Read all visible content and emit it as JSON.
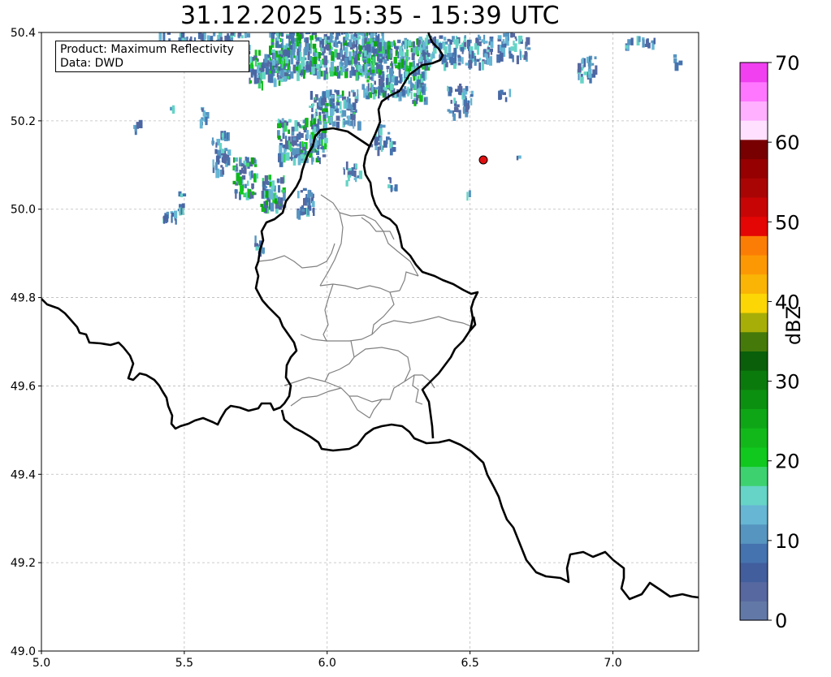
{
  "title": "31.12.2025 15:35 - 15:39 UTC",
  "info_box": {
    "product": "Product: Maximum Reflectivity",
    "data": "Data: DWD"
  },
  "colorbar": {
    "label": "dBZ",
    "min": 0,
    "max": 70,
    "ticks": [
      "0",
      "10",
      "20",
      "30",
      "40",
      "50",
      "60",
      "70"
    ],
    "colors": [
      "#6279a7",
      "#5768a0",
      "#425e9d",
      "#4573af",
      "#5795c1",
      "#66b6d4",
      "#66d4c6",
      "#3dd26f",
      "#10c81e",
      "#12b81a",
      "#0ea616",
      "#0c9010",
      "#0b7a0c",
      "#0a5f0a",
      "#457a0a",
      "#a8ae08",
      "#fcd605",
      "#f9b405",
      "#fd9805",
      "#fc7d05",
      "#e40505",
      "#c80505",
      "#aa0505",
      "#960000",
      "#780000",
      "#ffe0ff",
      "#ffb0ff",
      "#ff77ff",
      "#f040f0"
    ]
  },
  "chart_data": {
    "type": "map",
    "extent": {
      "lon": [
        5.0,
        7.3
      ],
      "lat": [
        49.0,
        50.4
      ]
    },
    "x_ticks": [
      "5.0",
      "5.5",
      "6.0",
      "6.5",
      "7.0"
    ],
    "y_ticks": [
      "49.0",
      "49.2",
      "49.4",
      "49.6",
      "49.8",
      "50.0",
      "50.2",
      "50.4"
    ],
    "grid": true,
    "marker": {
      "lon": 6.545,
      "lat": 50.11,
      "color": "#e01010"
    },
    "radar_echo_region": "north of Luxembourg, lon 5.3-6.9, lat 49.9-50.4, mostly 0-25 dBZ"
  }
}
